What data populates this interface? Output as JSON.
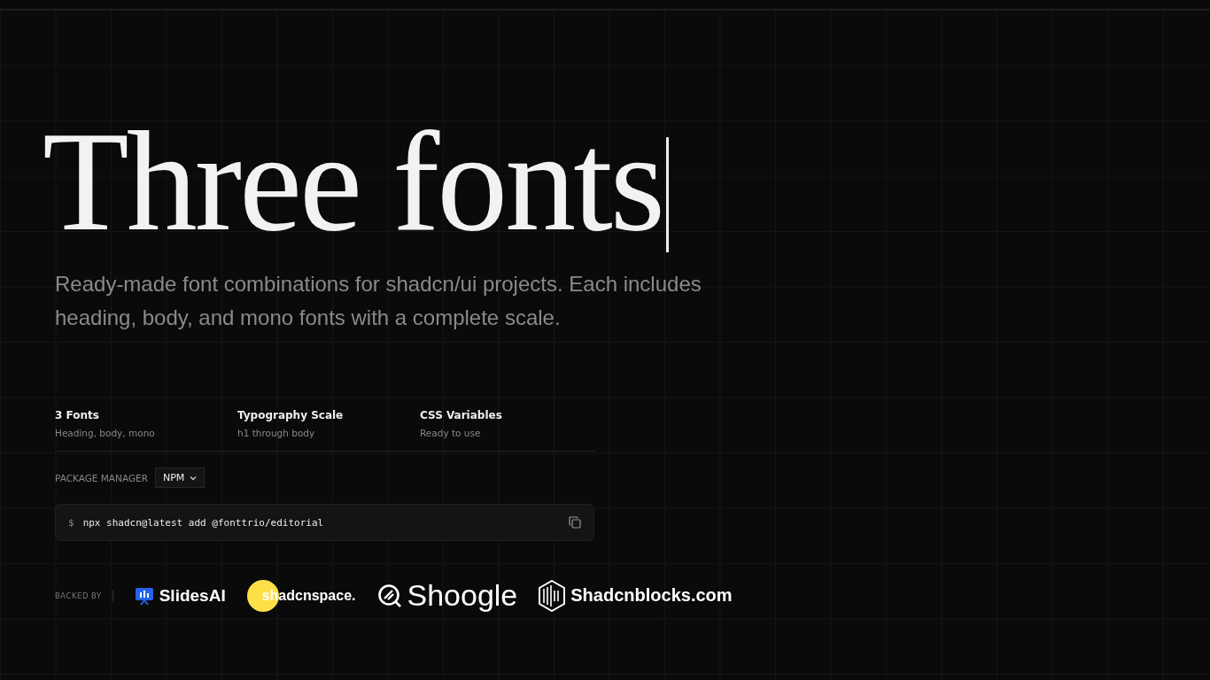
{
  "headline": "Three fonts",
  "subtitle": "Ready-made font combinations for shadcn/ui projects. Each includes heading, body, and mono fonts with a complete scale.",
  "features": [
    {
      "title": "3 Fonts",
      "description": "Heading, body, mono"
    },
    {
      "title": "Typography Scale",
      "description": "h1 through body"
    },
    {
      "title": "CSS Variables",
      "description": "Ready to use"
    }
  ],
  "package_manager": {
    "label": "PACKAGE MANAGER",
    "value": "NPM"
  },
  "command": {
    "prompt": "$",
    "text": "npx shadcn@latest add @fonttrio/editorial"
  },
  "backers": {
    "label": "BACKED BY",
    "items": [
      {
        "kind": "slides",
        "name": "SlidesAI"
      },
      {
        "kind": "space",
        "name": "shadcnspace."
      },
      {
        "kind": "shoogle",
        "name": "Shoogle"
      },
      {
        "kind": "blocks",
        "name": "Shadcnblocks.com"
      }
    ]
  }
}
